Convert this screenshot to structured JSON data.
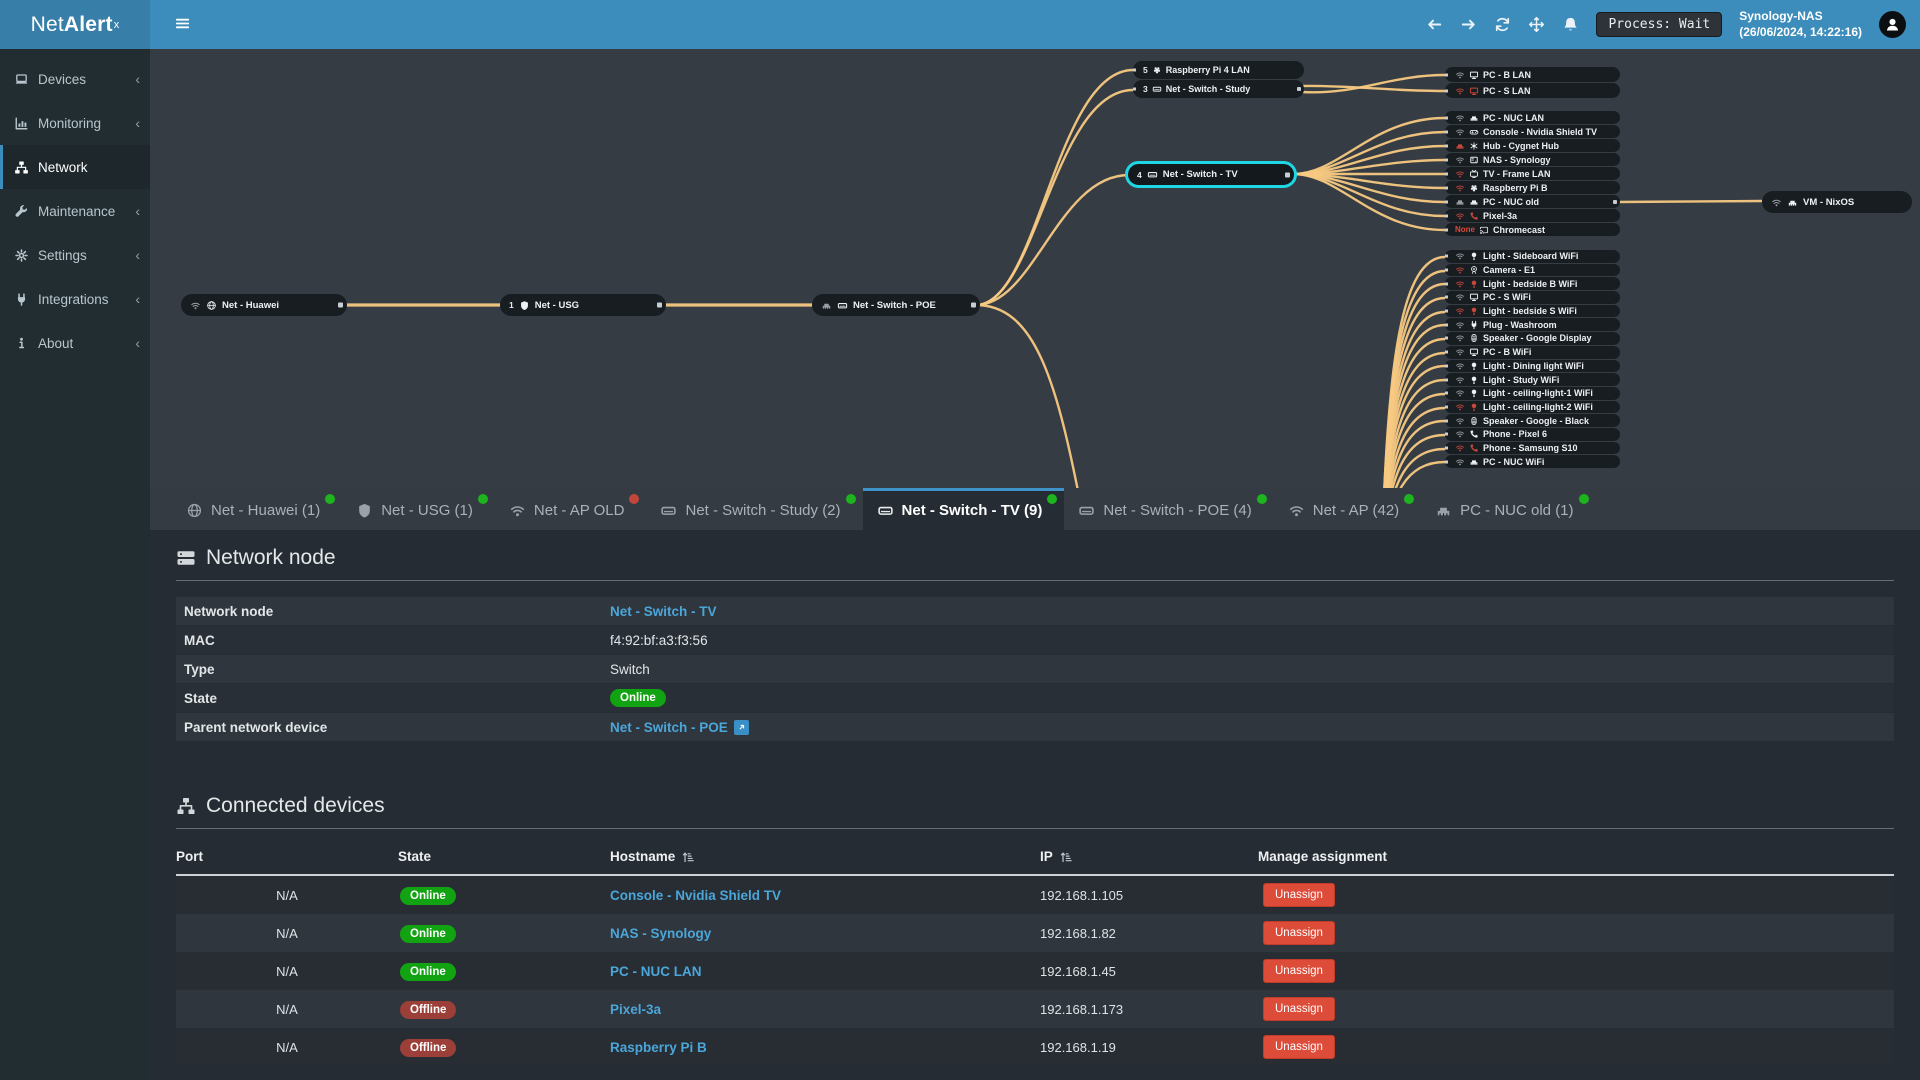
{
  "colors": {
    "accent": "#3c8dbc",
    "link": "#4ba6da",
    "online": "#12a312",
    "offline": "#9c3f38",
    "danger": "#dd4b39",
    "line": "#f8c982",
    "selected_border": "#1fd6e4",
    "dot_green": "#1eb41e",
    "dot_red": "#c2463a"
  },
  "header": {
    "logo_net": "Net",
    "logo_alert": "Alert",
    "logo_sup": "x",
    "process_label": "Process: Wait",
    "host_name": "Synology-NAS",
    "host_time": "(26/06/2024, 14:22:16)",
    "icons": [
      "arrow-left-icon",
      "arrow-right-icon",
      "refresh-icon",
      "move-icon",
      "bell-icon",
      "user-avatar"
    ]
  },
  "sidebar": {
    "items": [
      {
        "label": "Devices",
        "icon": "laptop",
        "chevron": "‹"
      },
      {
        "label": "Monitoring",
        "icon": "chart",
        "chevron": "‹"
      },
      {
        "label": "Network",
        "icon": "sitemap",
        "cls": "active",
        "chevron": ""
      },
      {
        "label": "Maintenance",
        "icon": "wrench",
        "chevron": "‹"
      },
      {
        "label": "Settings",
        "icon": "gear",
        "chevron": "‹"
      },
      {
        "label": "Integrations",
        "icon": "plug",
        "chevron": "‹"
      },
      {
        "label": "About",
        "icon": "info",
        "chevron": "‹"
      }
    ]
  },
  "diagram": {
    "huawei": {
      "label": "Net - Huawei",
      "conn_icon": "wifi",
      "dev_icon": "globe"
    },
    "usg": {
      "badge": "1",
      "label": "Net - USG",
      "dev_icon": "shield"
    },
    "poe": {
      "label": "Net - Switch - POE",
      "conn_icon": "eth",
      "dev_icon": "switch"
    },
    "selected": {
      "badge": "4",
      "label": "Net - Switch - TV",
      "dev_icon": "switch"
    },
    "vm": {
      "label": "VM - NixOS",
      "conn_icon": "wifi",
      "dev_icon": "eth"
    },
    "study": [
      {
        "badge": "5",
        "dev": "raspberry",
        "label": "Raspberry Pi 4 LAN"
      },
      {
        "badge": "3",
        "dev": "switch",
        "label": "Net - Switch - Study",
        "cls": "hasport"
      }
    ],
    "pc_lan": [
      {
        "conn": "wifi",
        "conn_cls": "gray",
        "dev": "monitor",
        "label": "PC - B LAN"
      },
      {
        "conn": "wifi",
        "conn_cls": "red",
        "dev": "monitor",
        "dev_cls": "red",
        "label": "PC - S LAN"
      }
    ],
    "tv_cluster": [
      {
        "conn": "wifi",
        "conn_cls": "gray",
        "dev": "eth",
        "label": "PC - NUC LAN"
      },
      {
        "conn": "wifi",
        "conn_cls": "gray",
        "dev": "gamepad",
        "label": "Console - Nvidia Shield TV"
      },
      {
        "conn": "eth",
        "conn_cls": "red",
        "dev": "hub",
        "label": "Hub - Cygnet Hub"
      },
      {
        "conn": "wifi",
        "conn_cls": "gray",
        "dev": "nas",
        "label": "NAS - Synology"
      },
      {
        "conn": "wifi",
        "conn_cls": "red",
        "dev": "tv",
        "label": "TV - Frame LAN"
      },
      {
        "conn": "wifi",
        "conn_cls": "red",
        "dev": "raspberry",
        "label": "Raspberry Pi B"
      },
      {
        "conn": "eth",
        "conn_cls": "gray",
        "dev": "eth",
        "label": "PC - NUC old",
        "cls": "hasport"
      },
      {
        "conn": "wifi",
        "conn_cls": "red",
        "dev": "phone",
        "dev_cls": "red",
        "label": "Pixel-3a"
      },
      {
        "conn_text": "None",
        "dev": "cast",
        "label": "Chromecast"
      }
    ],
    "wifi_cluster": [
      {
        "conn": "wifi",
        "conn_cls": "gray",
        "dev": "bulb",
        "label": "Light - Sideboard WiFi"
      },
      {
        "conn": "wifi",
        "conn_cls": "red",
        "dev": "camera",
        "label": "Camera - E1"
      },
      {
        "conn": "wifi",
        "conn_cls": "red",
        "dev": "bulb",
        "dev_cls": "red",
        "label": "Light - bedside B WiFi"
      },
      {
        "conn": "wifi",
        "conn_cls": "gray",
        "dev": "monitor",
        "label": "PC - S WiFi"
      },
      {
        "conn": "wifi",
        "conn_cls": "red",
        "dev": "bulb",
        "dev_cls": "red",
        "label": "Light - bedside S WiFi"
      },
      {
        "conn": "wifi",
        "conn_cls": "gray",
        "dev": "plug",
        "label": "Plug - Washroom"
      },
      {
        "conn": "wifi",
        "conn_cls": "gray",
        "dev": "speaker",
        "label": "Speaker - Google Display"
      },
      {
        "conn": "wifi",
        "conn_cls": "gray",
        "dev": "monitor",
        "label": "PC - B WiFi"
      },
      {
        "conn": "wifi",
        "conn_cls": "gray",
        "dev": "bulb",
        "label": "Light - Dining light WiFi"
      },
      {
        "conn": "wifi",
        "conn_cls": "gray",
        "dev": "bulb",
        "label": "Light - Study WiFi"
      },
      {
        "conn": "wifi",
        "conn_cls": "gray",
        "dev": "bulb",
        "label": "Light - ceiling-light-1 WiFi"
      },
      {
        "conn": "wifi",
        "conn_cls": "red",
        "dev": "bulb",
        "dev_cls": "red",
        "label": "Light - ceiling-light-2 WiFi"
      },
      {
        "conn": "wifi",
        "conn_cls": "gray",
        "dev": "speaker",
        "label": "Speaker - Google - Black"
      },
      {
        "conn": "wifi",
        "conn_cls": "gray",
        "dev": "phone",
        "label": "Phone - Pixel 6"
      },
      {
        "conn": "wifi",
        "conn_cls": "red",
        "dev": "phone",
        "dev_cls": "red",
        "label": "Phone - Samsung S10"
      },
      {
        "conn": "wifi",
        "conn_cls": "gray",
        "dev": "eth",
        "label": "PC - NUC WiFi"
      }
    ]
  },
  "tabs": [
    {
      "label": "Net - Huawei (1)",
      "icon": "globe",
      "dot": "green"
    },
    {
      "label": "Net - USG (1)",
      "icon": "shield",
      "dot": "green"
    },
    {
      "label": "Net - AP OLD",
      "icon": "wifi",
      "dot": "red"
    },
    {
      "label": "Net - Switch - Study (2)",
      "icon": "switch",
      "dot": "green"
    },
    {
      "label": "Net - Switch - TV (9)",
      "icon": "switch",
      "dot": "green",
      "cls": "active"
    },
    {
      "label": "Net - Switch - POE (4)",
      "icon": "switch",
      "dot": "green"
    },
    {
      "label": "Net - AP (42)",
      "icon": "wifi",
      "dot": "green"
    },
    {
      "label": "PC - NUC old (1)",
      "icon": "eth",
      "dot": "green"
    }
  ],
  "network_node": {
    "title": "Network node",
    "rows": [
      {
        "label": "Network node",
        "value": "Net - Switch - TV"
      },
      {
        "label": "MAC",
        "value": "f4:92:bf:a3:f3:56"
      },
      {
        "label": "Type",
        "value": "Switch"
      },
      {
        "label": "State",
        "value": "Online"
      },
      {
        "label": "Parent network device",
        "value": "Net - Switch - POE"
      }
    ]
  },
  "connected": {
    "title": "Connected devices",
    "columns": [
      "Port",
      "State",
      "Hostname",
      "IP",
      "Manage assignment"
    ],
    "unassign_label": "Unassign",
    "rows": [
      {
        "port": "N/A",
        "state": "Online",
        "state_cls": "online",
        "hostname": "Console - Nvidia Shield TV",
        "ip": "192.168.1.105",
        "cls": "dark"
      },
      {
        "port": "N/A",
        "state": "Online",
        "state_cls": "online",
        "hostname": "NAS - Synology",
        "ip": "192.168.1.82",
        "cls": "light"
      },
      {
        "port": "N/A",
        "state": "Online",
        "state_cls": "online",
        "hostname": "PC - NUC LAN",
        "ip": "192.168.1.45",
        "cls": "dark"
      },
      {
        "port": "N/A",
        "state": "Offline",
        "state_cls": "offline",
        "hostname": "Pixel-3a",
        "ip": "192.168.1.173",
        "cls": "light"
      },
      {
        "port": "N/A",
        "state": "Offline",
        "state_cls": "offline",
        "hostname": "Raspberry Pi B",
        "ip": "192.168.1.19",
        "cls": "dark"
      }
    ]
  }
}
